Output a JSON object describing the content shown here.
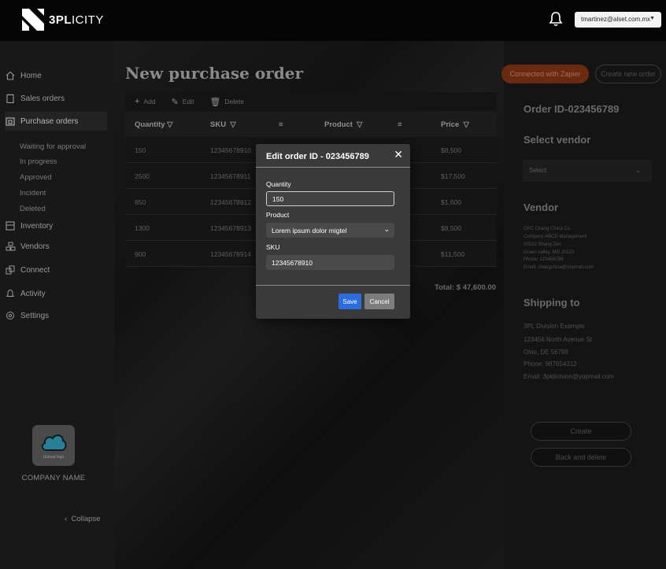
{
  "brand": {
    "name_bold": "3PL",
    "name_rest": "ICITY"
  },
  "header": {
    "user_email": "tmartinez@alset.com.mx"
  },
  "sidebar": {
    "items": [
      {
        "label": "Home",
        "icon": "home-icon"
      },
      {
        "label": "Sales orders",
        "icon": "sales-orders-icon"
      },
      {
        "label": "Purchase orders",
        "icon": "purchase-orders-icon"
      },
      {
        "label": "Inventory",
        "icon": "inventory-icon"
      },
      {
        "label": "Vendors",
        "icon": "vendors-icon"
      },
      {
        "label": "Connect",
        "icon": "connect-icon"
      },
      {
        "label": "Activity",
        "icon": "activity-icon"
      },
      {
        "label": "Settings",
        "icon": "settings-icon"
      }
    ],
    "sub_items": [
      "Waiting for approval",
      "In progress",
      "Approved",
      "Incident",
      "Deleted"
    ],
    "upload_label": "Upload logo",
    "company_name": "COMPANY NAME",
    "collapse_label": "Collapse"
  },
  "main": {
    "title": "New purchase order",
    "toolbar": {
      "add": "Add",
      "edit": "Edit",
      "delete": "Delete"
    },
    "columns": {
      "quantity": "Quantity",
      "sku": "SKU",
      "product": "Product",
      "price": "Price"
    },
    "rows": [
      {
        "quantity": "150",
        "sku": "12345678910",
        "price": "$8,500"
      },
      {
        "quantity": "2500",
        "sku": "12345678911",
        "price": "$17,500"
      },
      {
        "quantity": "850",
        "sku": "12345678912",
        "price": "$1,600"
      },
      {
        "quantity": "1300",
        "sku": "12345678913",
        "price": "$8,500"
      },
      {
        "quantity": "900",
        "sku": "12345678914",
        "price": "$11,500"
      }
    ],
    "total": "Total: $ 47,600.00"
  },
  "right": {
    "connected_zapier": "Connected with Zapier",
    "create_new_order": "Create new order",
    "order_id": "Order ID-023456789",
    "select_vendor_heading": "Select vendor",
    "vendor_select_placeholder": "Select",
    "vendor_heading": "Vendor",
    "vendor_lines": [
      "OPC Chang China Co.",
      "Company ABCD Management",
      "50532 Shang Zen",
      "Green valley, MD 20123",
      "Phone: 123456789",
      "Email: changchina@yopmail.com"
    ],
    "shipping_heading": "Shipping to",
    "shipping_lines": [
      "3PL Division Example",
      "123456 North Avenue St",
      "Ohio, DE 56789",
      "Phone: 987654312",
      "Email: 3pldivision@yopmail.com"
    ],
    "create": "Create",
    "back_and_delete": "Back and delete"
  },
  "modal": {
    "title": "Edit order ID - 023456789",
    "quantity_label": "Quantity",
    "quantity_value": "150",
    "product_label": "Product",
    "product_value": "Lorem ipsum dolor migtel",
    "sku_label": "SKU",
    "sku_value": "12345678910",
    "save": "Save",
    "cancel": "Cancel"
  }
}
